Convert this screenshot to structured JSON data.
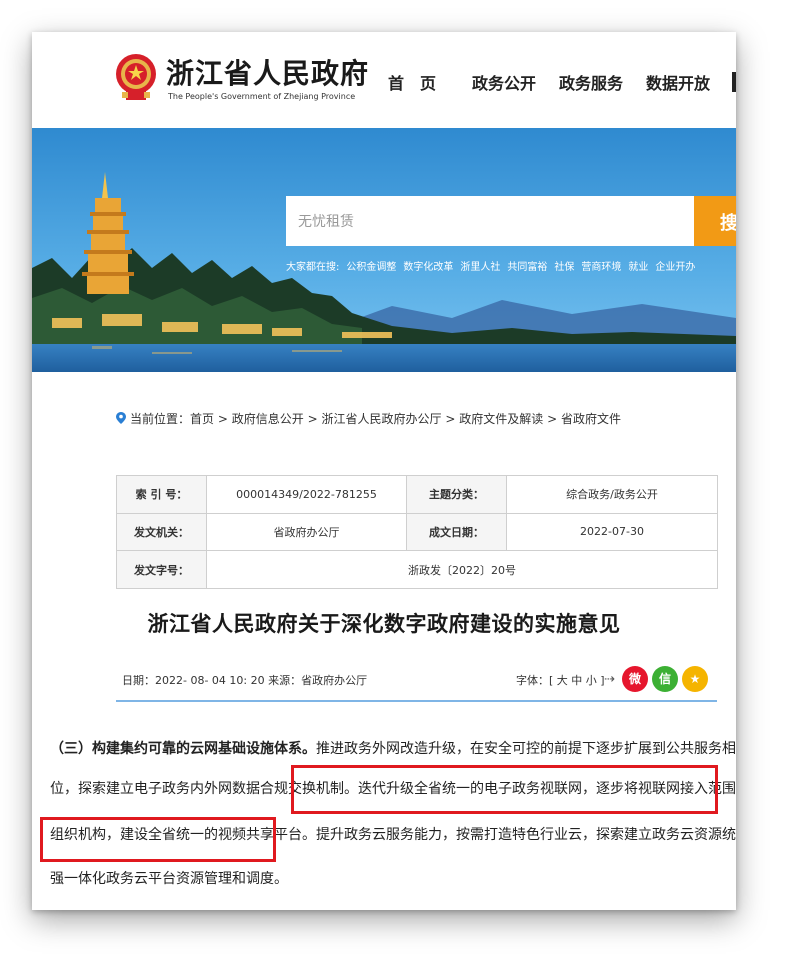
{
  "header": {
    "site_title": "浙江省人民政府",
    "site_subtitle": "The People's Government of Zhejiang Province",
    "nav": [
      "首　页",
      "政务公开",
      "政务服务",
      "数据开放"
    ]
  },
  "banner": {
    "search_placeholder": "无忧租赁",
    "search_button": "搜",
    "hot_prefix": "大家都在搜:",
    "hot_items": [
      "公积金调整",
      "数字化改革",
      "浙里人社",
      "共同富裕",
      "社保",
      "营商环境",
      "就业",
      "企业开办"
    ]
  },
  "breadcrumb": {
    "prefix": "当前位置：",
    "items": [
      "首页",
      "政府信息公开",
      "浙江省人民政府办公厅",
      "政府文件及解读",
      "省政府文件"
    ],
    "separator": ">"
  },
  "info": {
    "index_label": "索 引 号：",
    "index_value": "000014349/2022-781255",
    "topic_label": "主题分类：",
    "topic_value": "综合政务/政务公开",
    "issuer_label": "发文机关：",
    "issuer_value": "省政府办公厅",
    "date_label": "成文日期：",
    "date_value": "2022-07-30",
    "docno_label": "发文字号：",
    "docno_value": "浙政发〔2022〕20号"
  },
  "article": {
    "title": "浙江省人民政府关于深化数字政府建设的实施意见",
    "meta": "日期：2022- 08- 04 10: 20   来源：省政府办公厅",
    "font_size": "字体：[ 大 中 小 ]",
    "lines": [
      "（三）构建集约可靠的云网基础设施体系。推进政务外网改造升级，在安全可控的前提下逐步扩展到公共服务相关企事业单",
      "位，探索建立电子政务内外网数据合规交换机制。迭代升级全省统一的电子政务视联网，逐步将视联网接入范围扩展到关键社会",
      "组织机构，建设全省统一的视频共享平台。提升政务云服务能力，按需打造特色行业云，探索建立政务云资源统一调度机制，加",
      "强一体化政务云平台资源管理和调度。"
    ],
    "line1_bold": "（三）构建集约可靠的云网基础设施体系。",
    "line1_rest": "推进政务外网改造升级，在安全可控的前提下逐步扩展到公共服务相关企事业单"
  },
  "colors": {
    "search_button": "#f29a15",
    "highlight_box": "#e0191f",
    "weibo": "#e6162d",
    "wechat": "#3cb034",
    "favorite": "#f5b400",
    "divider": "#7fb5e6"
  },
  "icons": [
    "national-emblem-icon",
    "location-pin-icon",
    "share-icon",
    "weibo-icon",
    "wechat-icon",
    "favorite-icon"
  ]
}
